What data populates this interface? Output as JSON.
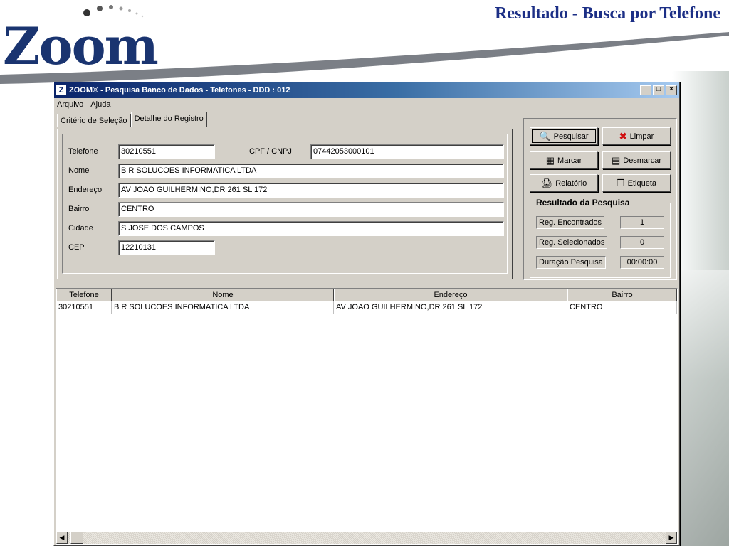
{
  "slide": {
    "title": "Resultado - Busca por Telefone",
    "logo_text": "Zoom"
  },
  "window": {
    "title": "ZOOM® - Pesquisa Banco de Dados - Telefones - DDD : 012",
    "app_icon_letter": "Z",
    "minimize": "_",
    "maximize": "□",
    "close": "×"
  },
  "menu": {
    "arquivo": "Arquivo",
    "ajuda": "Ajuda"
  },
  "tabs": {
    "criterio": "Critério de Seleção",
    "detalhe": "Detalhe do Registro"
  },
  "detail": {
    "telefone_label": "Telefone",
    "telefone": "30210551",
    "cpf_label": "CPF / CNPJ",
    "cpf": "07442053000101",
    "nome_label": "Nome",
    "nome": "B R SOLUCOES INFORMATICA LTDA",
    "endereco_label": "Endereço",
    "endereco": "AV JOAO GUILHERMINO,DR 261 SL 172",
    "bairro_label": "Bairro",
    "bairro": "CENTRO",
    "cidade_label": "Cidade",
    "cidade": "S JOSE DOS CAMPOS",
    "cep_label": "CEP",
    "cep": "12210131"
  },
  "buttons": {
    "pesquisar": "Pesquisar",
    "limpar": "Limpar",
    "marcar": "Marcar",
    "desmarcar": "Desmarcar",
    "relatorio": "Relatório",
    "etiqueta": "Etiqueta"
  },
  "result": {
    "title": "Resultado da Pesquisa",
    "encontrados_label": "Reg. Encontrados",
    "encontrados": "1",
    "selecionados_label": "Reg. Selecionados",
    "selecionados": "0",
    "duracao_label": "Duração Pesquisa",
    "duracao": "00:00:00"
  },
  "grid": {
    "headers": [
      "Telefone",
      "Nome",
      "Endereço",
      "Bairro"
    ],
    "rows": [
      [
        "30210551",
        "B R SOLUCOES INFORMATICA LTDA",
        "AV JOAO GUILHERMINO,DR 261 SL 172",
        "CENTRO"
      ]
    ]
  },
  "icons": {
    "pesquisar": "magnifier-icon",
    "limpar": "red-x-icon",
    "marcar": "mark-icon",
    "desmarcar": "unmark-icon",
    "relatorio": "report-icon",
    "etiqueta": "label-icon"
  },
  "colors": {
    "title_blue": "#1c2f86",
    "titlebar": "#0a246a",
    "limpar_x": "#d01010"
  }
}
